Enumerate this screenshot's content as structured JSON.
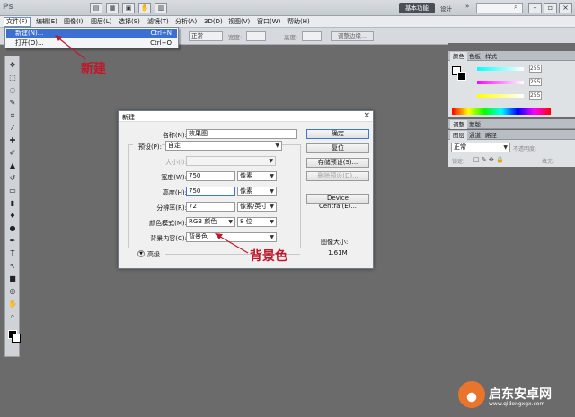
{
  "app": {
    "logo": "Ps",
    "workspace_button": "基本功能",
    "design_link": "设计",
    "more": "»"
  },
  "menubar": {
    "items": [
      "文件(F)",
      "编辑(E)",
      "图像(I)",
      "图层(L)",
      "选择(S)",
      "滤镜(T)",
      "分析(A)",
      "3D(D)",
      "视图(V)",
      "窗口(W)",
      "帮助(H)"
    ]
  },
  "file_menu": {
    "items": [
      {
        "label": "新建(N)...",
        "shortcut": "Ctrl+N"
      },
      {
        "label": "打开(O)...",
        "shortcut": "Ctrl+O"
      }
    ]
  },
  "options_bar": {
    "style_value": "正常",
    "width_label": "宽度:",
    "height_label": "高度:",
    "adjust_edge": "调整边缘..."
  },
  "panels": {
    "color_tabs": [
      "颜色",
      "色板",
      "样式"
    ],
    "color_values": [
      "255",
      "255",
      "255"
    ],
    "adjust_tabs": [
      "调整",
      "蒙版"
    ],
    "layer_tabs": [
      "图层",
      "通道",
      "路径"
    ],
    "blend_mode": "正常",
    "opacity_label": "不透明度:",
    "lock_label": "锁定:",
    "fill_label": "填充:"
  },
  "dialog": {
    "title": "新建",
    "close": "×",
    "name_label": "名称(N):",
    "name_value": "效果图",
    "preset_label": "预设(P):",
    "preset_value": "自定",
    "size_label": "大小(I):",
    "width_label": "宽度(W):",
    "width_value": "750",
    "width_unit": "像素",
    "height_label": "高度(H):",
    "height_value": "750",
    "height_unit": "像素",
    "resolution_label": "分辨率(R):",
    "resolution_value": "72",
    "resolution_unit": "像素/英寸",
    "color_mode_label": "颜色模式(M):",
    "color_mode_value": "RGB 颜色",
    "bit_depth_value": "8 位",
    "bg_contents_label": "背景内容(C):",
    "bg_contents_value": "背景色",
    "advanced_label": "高级",
    "buttons": {
      "ok": "确定",
      "reset": "复位",
      "save_preset": "存储预设(S)...",
      "delete_preset": "删除预设(D)...",
      "device_central": "Device Central(E)..."
    },
    "image_size_label": "图像大小:",
    "image_size_value": "1.61M"
  },
  "annotations": {
    "new": "新建",
    "background_color": "背景色"
  },
  "watermark": {
    "text": "启东安卓网",
    "url": "www.qidongxgx.com"
  },
  "colors": {
    "accent": "#3b6fd1",
    "annotation": "#c0182a"
  }
}
